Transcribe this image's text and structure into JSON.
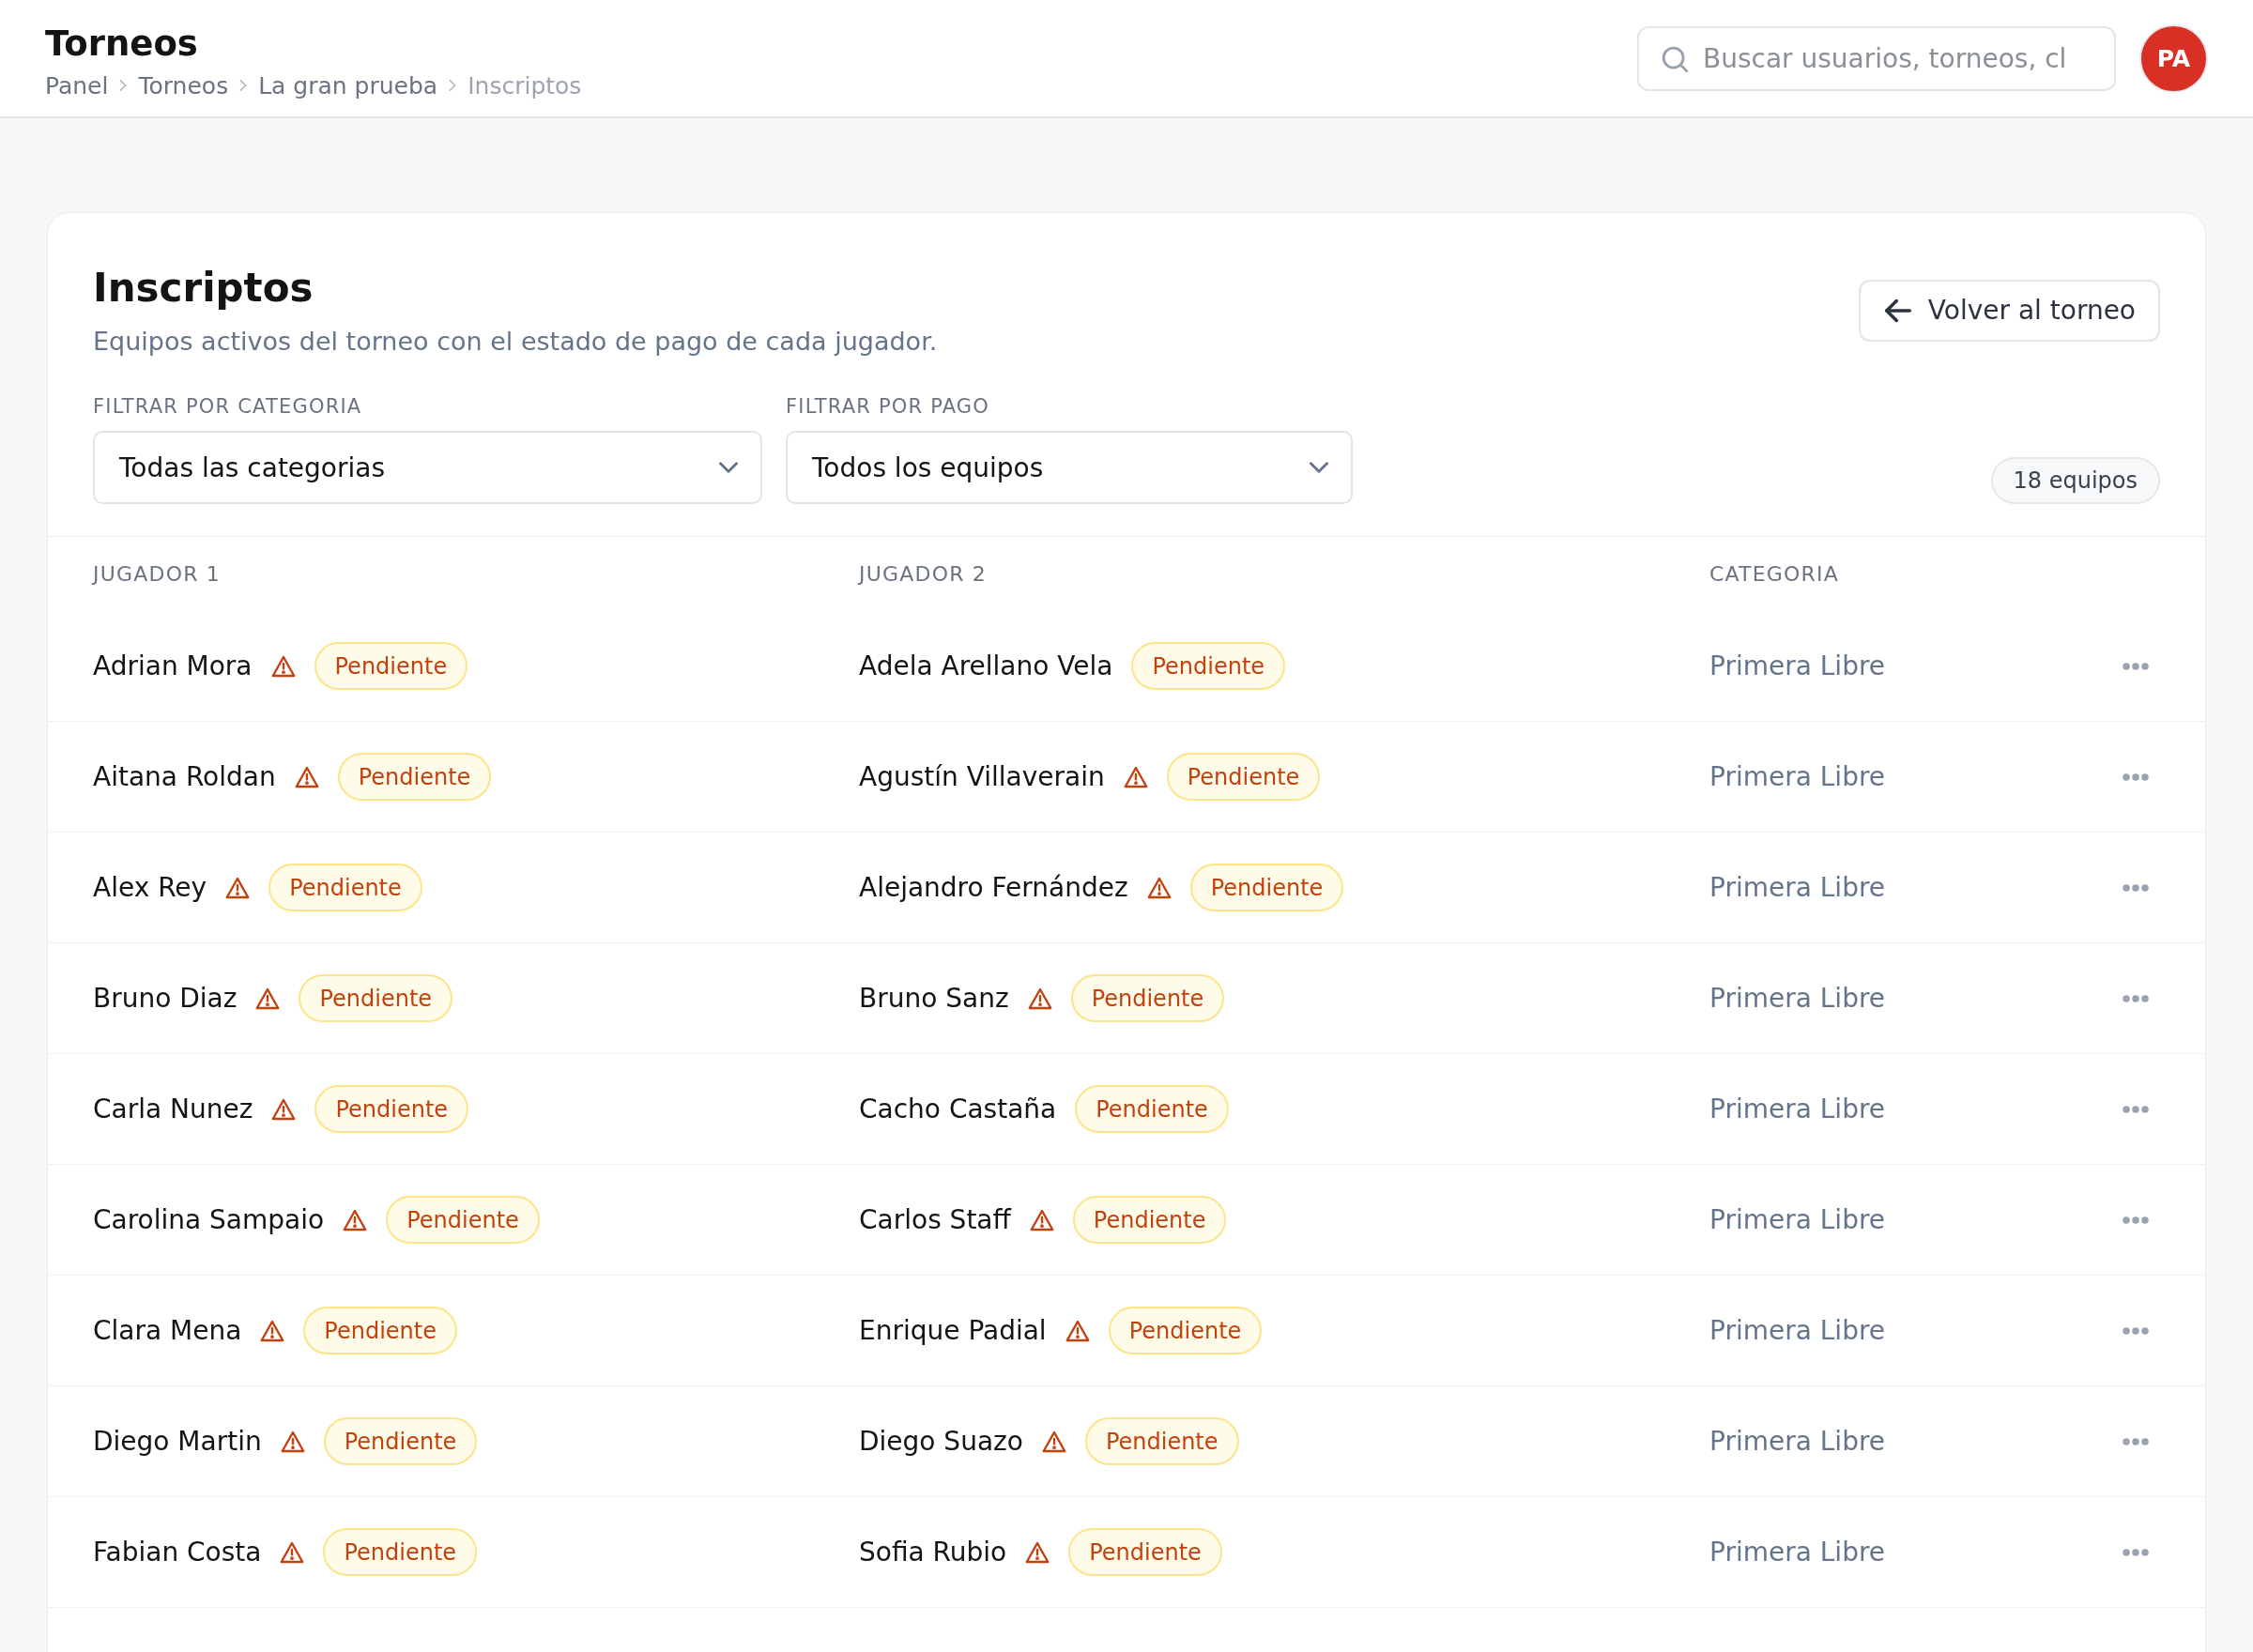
{
  "header": {
    "title": "Torneos",
    "breadcrumb": [
      {
        "label": "Panel",
        "current": false
      },
      {
        "label": "Torneos",
        "current": false
      },
      {
        "label": "La gran prueba",
        "current": false
      },
      {
        "label": "Inscriptos",
        "current": true
      }
    ],
    "search": {
      "placeholder": "Buscar usuarios, torneos, cl"
    },
    "avatar": {
      "initials": "PA"
    }
  },
  "section": {
    "title": "Inscriptos",
    "subtitle": "Equipos activos del torneo con el estado de pago de cada jugador.",
    "back_button": {
      "label": "Volver al torneo"
    },
    "filters": [
      {
        "label": "FILTRAR POR CATEGORIA",
        "value": "Todas las categorias"
      },
      {
        "label": "FILTRAR POR PAGO",
        "value": "Todos los equipos"
      }
    ],
    "count": "18 equipos"
  },
  "table": {
    "columns": [
      "JUGADOR 1",
      "JUGADOR 2",
      "CATEGORIA"
    ],
    "rows": [
      {
        "player_1": {
          "name": "Adrian Mora",
          "warning": true,
          "status": "Pendiente"
        },
        "player_2": {
          "name": "Adela Arellano Vela",
          "warning": false,
          "status": "Pendiente"
        },
        "category": "Primera Libre"
      },
      {
        "player_1": {
          "name": "Aitana Roldan",
          "warning": true,
          "status": "Pendiente"
        },
        "player_2": {
          "name": "Agustín Villaverain",
          "warning": true,
          "status": "Pendiente"
        },
        "category": "Primera Libre"
      },
      {
        "player_1": {
          "name": "Alex Rey",
          "warning": true,
          "status": "Pendiente"
        },
        "player_2": {
          "name": "Alejandro Fernández",
          "warning": true,
          "status": "Pendiente"
        },
        "category": "Primera Libre"
      },
      {
        "player_1": {
          "name": "Bruno Diaz",
          "warning": true,
          "status": "Pendiente"
        },
        "player_2": {
          "name": "Bruno Sanz",
          "warning": true,
          "status": "Pendiente"
        },
        "category": "Primera Libre"
      },
      {
        "player_1": {
          "name": "Carla Nunez",
          "warning": true,
          "status": "Pendiente"
        },
        "player_2": {
          "name": "Cacho Castaña",
          "warning": false,
          "status": "Pendiente"
        },
        "category": "Primera Libre"
      },
      {
        "player_1": {
          "name": "Carolina Sampaio",
          "warning": true,
          "status": "Pendiente"
        },
        "player_2": {
          "name": "Carlos Staff",
          "warning": true,
          "status": "Pendiente"
        },
        "category": "Primera Libre"
      },
      {
        "player_1": {
          "name": "Clara Mena",
          "warning": true,
          "status": "Pendiente"
        },
        "player_2": {
          "name": "Enrique Padial",
          "warning": true,
          "status": "Pendiente"
        },
        "category": "Primera Libre"
      },
      {
        "player_1": {
          "name": "Diego Martin",
          "warning": true,
          "status": "Pendiente"
        },
        "player_2": {
          "name": "Diego Suazo",
          "warning": true,
          "status": "Pendiente"
        },
        "category": "Primera Libre"
      },
      {
        "player_1": {
          "name": "Fabian Costa",
          "warning": true,
          "status": "Pendiente"
        },
        "player_2": {
          "name": "Sofia Rubio",
          "warning": true,
          "status": "Pendiente"
        },
        "category": "Primera Libre"
      }
    ]
  }
}
